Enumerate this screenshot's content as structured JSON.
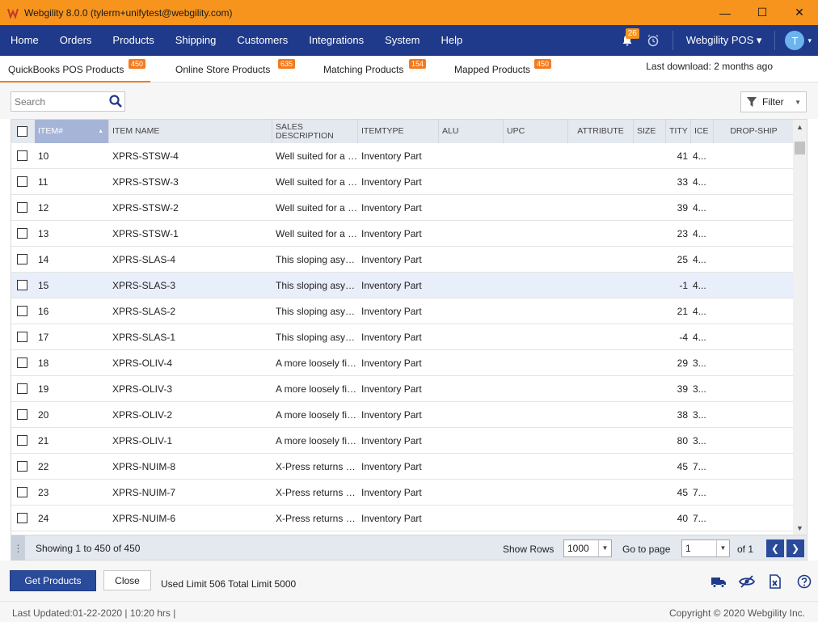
{
  "window": {
    "title": "Webgility 8.0.0 (tylerm+unifytest@webgility.com)",
    "minimize": "—",
    "maximize": "☐",
    "close": "✕"
  },
  "menu": {
    "items": [
      "Home",
      "Orders",
      "Products",
      "Shipping",
      "Customers",
      "Integrations",
      "System",
      "Help"
    ],
    "notification_count": "26",
    "pos_label": "Webgility POS ▾",
    "avatar_letter": "T",
    "avatar_caret": "▾"
  },
  "tabs": [
    {
      "label": "QuickBooks POS Products",
      "count": "450",
      "active": true
    },
    {
      "label": "Online Store Products",
      "count": "635",
      "active": false
    },
    {
      "label": "Matching Products",
      "count": "154",
      "active": false
    },
    {
      "label": "Mapped Products",
      "count": "450",
      "active": false
    }
  ],
  "last_download": "Last download: 2 months ago",
  "search": {
    "placeholder": "Search",
    "value": ""
  },
  "filter": {
    "label": "Filter",
    "caret": "▼"
  },
  "grid": {
    "columns": [
      "ITEM#",
      "ITEM NAME",
      "SALES DESCRIPTION",
      "ITEMTYPE",
      "ALU",
      "UPC",
      "ATTRIBUTE",
      "SIZE",
      "TITY",
      "ICE",
      "DROP-SHIP"
    ],
    "rows": [
      {
        "item": "10",
        "name": "XPRS-STSW-4",
        "desc": "Well suited for a wide range",
        "type": "Inventory Part",
        "qty": "41",
        "price": "4..."
      },
      {
        "item": "11",
        "name": "XPRS-STSW-3",
        "desc": "Well suited for a wide range",
        "type": "Inventory Part",
        "qty": "33",
        "price": "4..."
      },
      {
        "item": "12",
        "name": "XPRS-STSW-2",
        "desc": "Well suited for a wide range",
        "type": "Inventory Part",
        "qty": "39",
        "price": "4..."
      },
      {
        "item": "13",
        "name": "XPRS-STSW-1",
        "desc": "Well suited for a wide range",
        "type": "Inventory Part",
        "qty": "23",
        "price": "4..."
      },
      {
        "item": "14",
        "name": "XPRS-SLAS-4",
        "desc": "This sloping asymmetrical",
        "type": "Inventory Part",
        "qty": "25",
        "price": "4..."
      },
      {
        "item": "15",
        "name": "XPRS-SLAS-3",
        "desc": "This sloping asymmetrical",
        "type": "Inventory Part",
        "qty": "-1",
        "price": "4..."
      },
      {
        "item": "16",
        "name": "XPRS-SLAS-2",
        "desc": "This sloping asymmetrical",
        "type": "Inventory Part",
        "qty": "21",
        "price": "4..."
      },
      {
        "item": "17",
        "name": "XPRS-SLAS-1",
        "desc": "This sloping asymmetrical",
        "type": "Inventory Part",
        "qty": "-4",
        "price": "4..."
      },
      {
        "item": "18",
        "name": "XPRS-OLIV-4",
        "desc": "A more loosely fitted",
        "type": "Inventory Part",
        "qty": "29",
        "price": "3..."
      },
      {
        "item": "19",
        "name": "XPRS-OLIV-3",
        "desc": "A more loosely fitted",
        "type": "Inventory Part",
        "qty": "39",
        "price": "3..."
      },
      {
        "item": "20",
        "name": "XPRS-OLIV-2",
        "desc": "A more loosely fitted",
        "type": "Inventory Part",
        "qty": "38",
        "price": "3..."
      },
      {
        "item": "21",
        "name": "XPRS-OLIV-1",
        "desc": "A more loosely fitted",
        "type": "Inventory Part",
        "qty": "80",
        "price": "3..."
      },
      {
        "item": "22",
        "name": "XPRS-NUIM-8",
        "desc": "X-Press returns with",
        "type": "Inventory Part",
        "qty": "45",
        "price": "7..."
      },
      {
        "item": "23",
        "name": "XPRS-NUIM-7",
        "desc": "X-Press returns with",
        "type": "Inventory Part",
        "qty": "45",
        "price": "7..."
      },
      {
        "item": "24",
        "name": "XPRS-NUIM-6",
        "desc": "X-Press returns with",
        "type": "Inventory Part",
        "qty": "40",
        "price": "7..."
      }
    ]
  },
  "pager": {
    "showing": "Showing 1 to 450 of 450",
    "show_rows_label": "Show Rows",
    "show_rows_value": "1000",
    "go_to_label": "Go to page",
    "page_value": "1",
    "of_label": "of 1",
    "prev": "❮",
    "next": "❯"
  },
  "actions": {
    "get_products": "Get Products",
    "close": "Close",
    "limits": "Used Limit 506  Total Limit 5000"
  },
  "status": {
    "left": "Last Updated:01-22-2020  |  10:20 hrs  |",
    "right": "Copyright © 2020 Webgility Inc."
  },
  "icons": [
    "truck-icon",
    "eye-off-icon",
    "excel-export-icon",
    "help-icon",
    "search-icon",
    "filter-icon",
    "bell-icon",
    "alarm-icon"
  ],
  "colors": {
    "title_bar": "#f7941d",
    "menu_bar": "#1f3a8a",
    "badge": "#f47a20",
    "primary": "#2a4a9a"
  }
}
